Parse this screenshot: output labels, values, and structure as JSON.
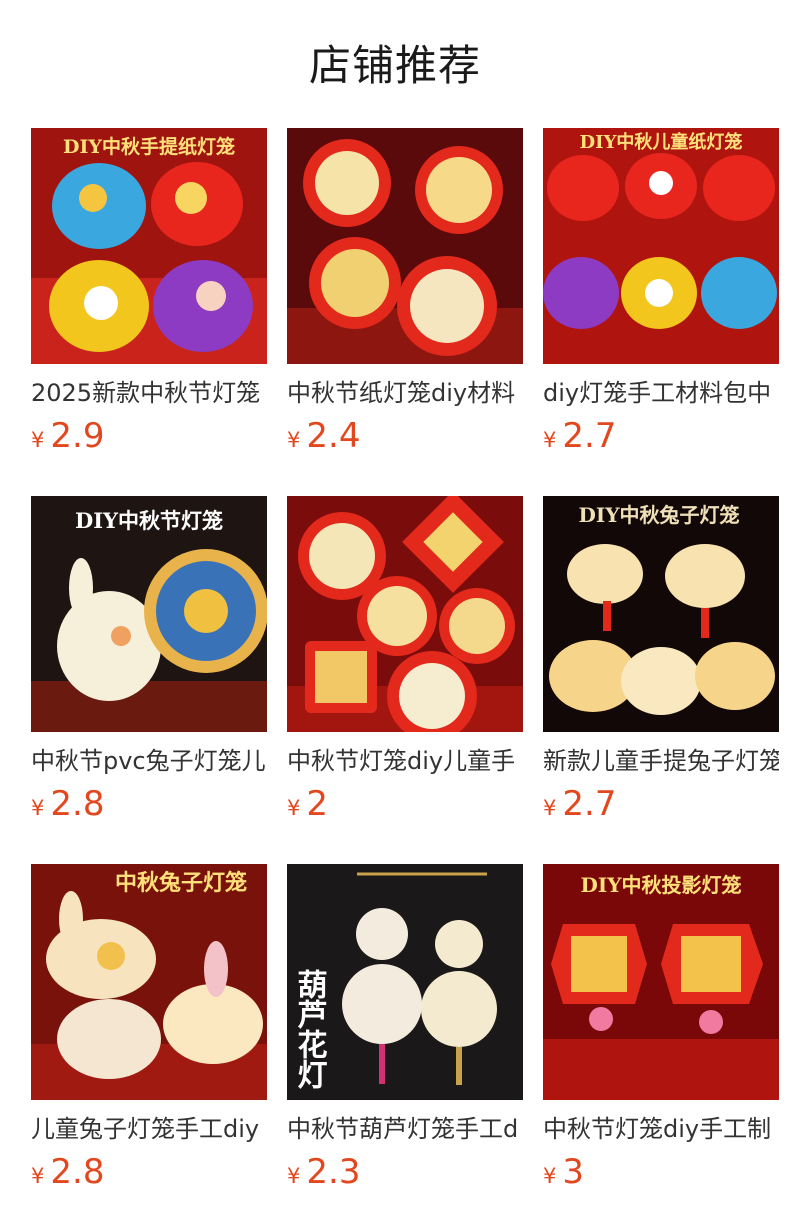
{
  "header": {
    "title": "店铺推荐"
  },
  "colors": {
    "price": "#e2481f",
    "title": "#1a1a1a",
    "name": "#333333"
  },
  "products": [
    {
      "name": "2025新款中秋节灯笼",
      "currency": "¥",
      "price": "2.9",
      "banner": "DIY中秋手提纸灯笼",
      "thumb_icon": "paper-lantern-icon"
    },
    {
      "name": "中秋节纸灯笼diy材料",
      "currency": "¥",
      "price": "2.4",
      "banner": "",
      "thumb_icon": "round-lantern-icon"
    },
    {
      "name": "diy灯笼手工材料包中",
      "currency": "¥",
      "price": "2.7",
      "banner": "DIY中秋儿童纸灯笼",
      "thumb_icon": "paper-lantern-icon"
    },
    {
      "name": "中秋节pvc兔子灯笼儿",
      "currency": "¥",
      "price": "2.8",
      "banner": "DIY中秋节灯笼",
      "thumb_icon": "rabbit-lantern-icon"
    },
    {
      "name": "中秋节灯笼diy儿童手",
      "currency": "¥",
      "price": "2",
      "banner": "",
      "thumb_icon": "round-lantern-icon"
    },
    {
      "name": "新款儿童手提兔子灯笼",
      "currency": "¥",
      "price": "2.7",
      "banner": "DIY中秋兔子灯笼",
      "thumb_icon": "rabbit-lantern-icon"
    },
    {
      "name": "儿童兔子灯笼手工diy",
      "currency": "¥",
      "price": "2.8",
      "banner": "中秋兔子灯笼",
      "thumb_icon": "rabbit-lantern-icon"
    },
    {
      "name": "中秋节葫芦灯笼手工d",
      "currency": "¥",
      "price": "2.3",
      "banner": "葫芦花灯",
      "thumb_icon": "gourd-lantern-icon"
    },
    {
      "name": "中秋节灯笼diy手工制",
      "currency": "¥",
      "price": "3",
      "banner": "DIY中秋投影灯笼",
      "thumb_icon": "hexagon-lantern-icon"
    }
  ]
}
